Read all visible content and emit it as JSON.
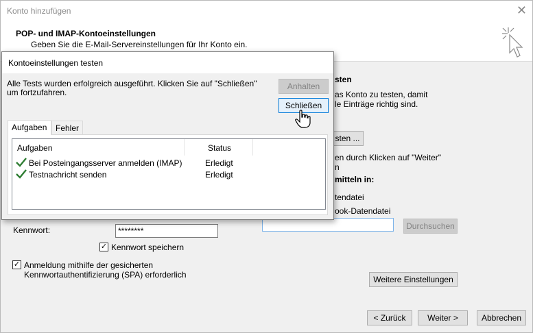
{
  "wizard": {
    "title": "Konto hinzufügen",
    "close_glyph": "✕",
    "header_title": "POP- und IMAP-Kontoeinstellungen",
    "header_subtitle": "Geben Sie die E-Mail-Servereinstellungen für Ihr Konto ein.",
    "right_panel": {
      "heading_fragment": "sten",
      "line1": "as Konto zu testen, damit",
      "line2": "le Einträge richtig sind.",
      "test_button": "sten ...",
      "line3": "en durch Klicken auf \"Weiter\"",
      "line4": "n",
      "deliver_heading": "mitteln in:",
      "option1": "tendatei",
      "option2": "ook-Datendatei",
      "browse_button": "Durchsuchen"
    },
    "password_label": "Kennwort:",
    "password_value": "********",
    "remember_password_label": "Kennwort speichern",
    "spa_label_line1": "Anmeldung mithilfe der gesicherten",
    "spa_label_line2": "Kennwortauthentifizierung (SPA) erforderlich",
    "more_settings_button": "Weitere Einstellungen",
    "back_button": "< Zurück",
    "next_button": "Weiter >",
    "cancel_button": "Abbrechen"
  },
  "test_dialog": {
    "title": "Kontoeinstellungen testen",
    "message": "Alle Tests wurden erfolgreich ausgeführt. Klicken Sie auf \"Schließen\" um fortzufahren.",
    "stop_button": "Anhalten",
    "close_button": "Schließen",
    "tabs": [
      {
        "label": "Aufgaben",
        "active": true
      },
      {
        "label": "Fehler",
        "active": false
      }
    ],
    "columns": [
      "Aufgaben",
      "Status"
    ],
    "rows": [
      {
        "task": "Bei Posteingangsserver anmelden (IMAP)",
        "status": "Erledigt"
      },
      {
        "task": "Testnachricht senden",
        "status": "Erledigt"
      }
    ]
  },
  "colors": {
    "accent": "#0078d7",
    "success_check": "#2e7d32",
    "window_bg": "#f0f0f0"
  },
  "icons": [
    "close-icon",
    "sparkle-cursor-icon",
    "checkmark-icon",
    "hand-pointer-icon"
  ]
}
